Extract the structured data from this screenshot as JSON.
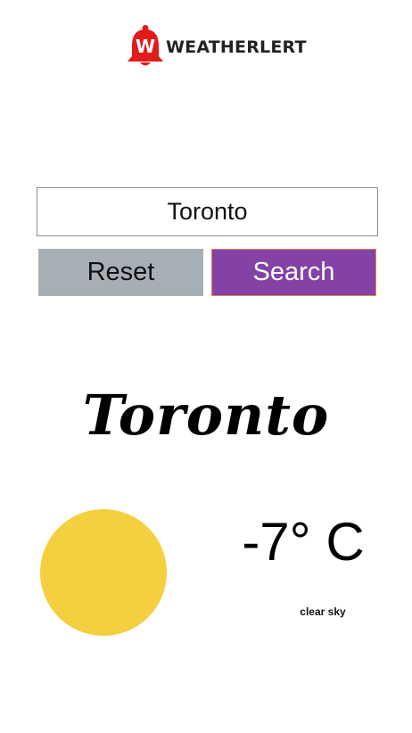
{
  "logo": {
    "brand_text": "WEATHERLERT",
    "bell_letter": "W",
    "bell_color": "#e21b1b"
  },
  "search": {
    "value": "Toronto"
  },
  "buttons": {
    "reset_label": "Reset",
    "search_label": "Search",
    "reset_color": "#a7afb6",
    "search_color": "#8542a6"
  },
  "weather": {
    "city": "Toronto",
    "temperature": "-7° C",
    "condition": "clear sky",
    "icon": "sun-icon",
    "sun_color": "#f4cf3f"
  }
}
